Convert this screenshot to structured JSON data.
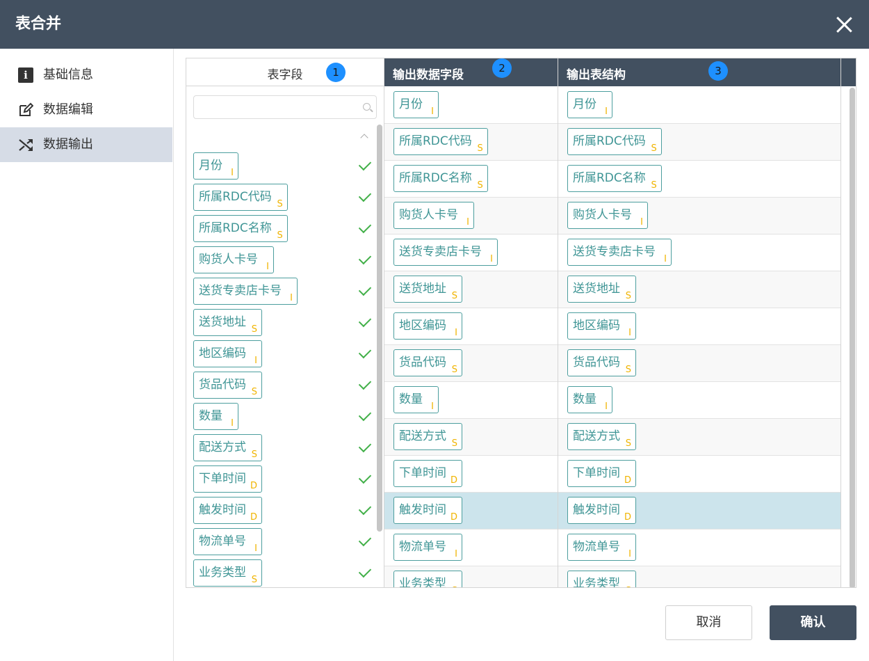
{
  "dialog": {
    "title": "表合并",
    "close_icon": "close-icon"
  },
  "sidebar": {
    "items": [
      {
        "label": "基础信息",
        "icon": "info-icon",
        "active": false
      },
      {
        "label": "数据编辑",
        "icon": "edit-icon",
        "active": false
      },
      {
        "label": "数据输出",
        "icon": "shuffle-icon",
        "active": true
      }
    ]
  },
  "columns": {
    "table_fields": {
      "header": "表字段",
      "badge": "1"
    },
    "output_data_fields": {
      "header": "输出数据字段",
      "badge": "2"
    },
    "output_table_structure": {
      "header": "输出表结构",
      "badge": "3"
    }
  },
  "search": {
    "value": "",
    "placeholder": "",
    "icon": "search-icon"
  },
  "fields": [
    {
      "name": "月份",
      "type": "I",
      "checked": true
    },
    {
      "name": "所属RDC代码",
      "type": "S",
      "checked": true
    },
    {
      "name": "所属RDC名称",
      "type": "S",
      "checked": true
    },
    {
      "name": "购货人卡号",
      "type": "I",
      "checked": true
    },
    {
      "name": "送货专卖店卡号",
      "type": "I",
      "checked": true
    },
    {
      "name": "送货地址",
      "type": "S",
      "checked": true
    },
    {
      "name": "地区编码",
      "type": "I",
      "checked": true
    },
    {
      "name": "货品代码",
      "type": "S",
      "checked": true
    },
    {
      "name": "数量",
      "type": "I",
      "checked": true
    },
    {
      "name": "配送方式",
      "type": "S",
      "checked": true
    },
    {
      "name": "下单时间",
      "type": "D",
      "checked": true
    },
    {
      "name": "触发时间",
      "type": "D",
      "checked": true
    },
    {
      "name": "物流单号",
      "type": "I",
      "checked": true
    },
    {
      "name": "业务类型",
      "type": "S",
      "checked": true
    }
  ],
  "selected_row": "触发时间",
  "footer": {
    "cancel_label": "取消",
    "confirm_label": "确认"
  },
  "colors": {
    "header_bg": "#425060",
    "tag_border": "#4c9e9e",
    "type_letter": "#f0b400",
    "check": "#42b049",
    "selected_row": "#cce4ec",
    "badge": "#1e90ff"
  }
}
